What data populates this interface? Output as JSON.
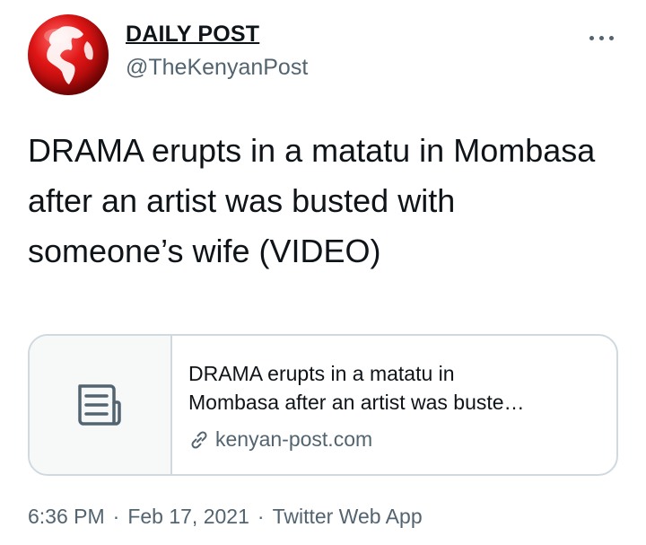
{
  "account": {
    "display_name": "DAILY POST",
    "handle": "@TheKenyanPost",
    "avatar_icon": "globe-logo-icon",
    "brand_color": "#d81b1b"
  },
  "more_icon": "more-horizontal-icon",
  "tweet": {
    "text": "DRAMA erupts in a matatu in Mombasa after an artist was busted with someone’s wife (VIDEO)"
  },
  "card": {
    "thumbnail_icon": "article-document-icon",
    "title_line1": "DRAMA erupts in a matatu in",
    "title_line2": "Mombasa after an artist was buste…",
    "domain_icon": "link-icon",
    "domain": "kenyan-post.com"
  },
  "meta": {
    "time": "6:36 PM",
    "date": "Feb 17, 2021",
    "source": "Twitter Web App",
    "separator": "·"
  }
}
